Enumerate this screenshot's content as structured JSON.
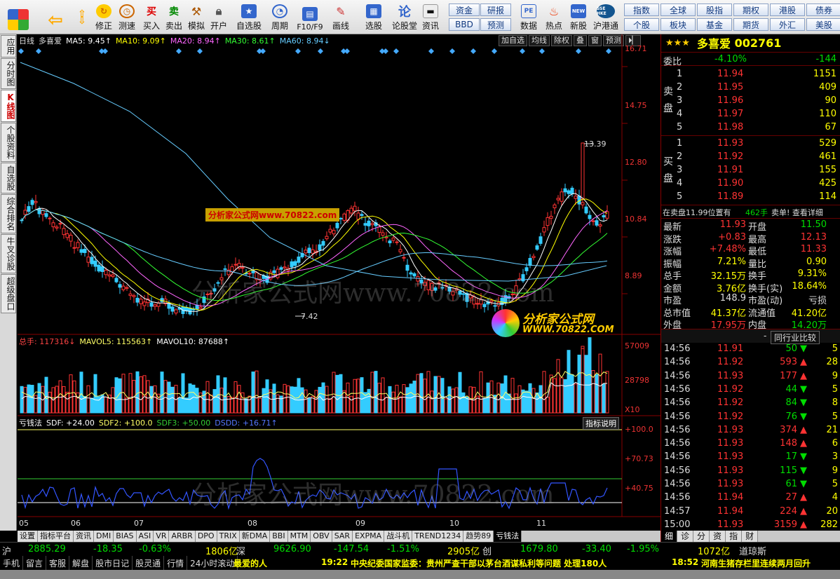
{
  "toolbar": {
    "items": [
      "修正",
      "测速",
      "买入",
      "卖出",
      "模拟",
      "开户",
      "自选股",
      "周期",
      "F10/F9",
      "画线",
      "选股",
      "论股堂",
      "资讯",
      "数据",
      "热点",
      "新股",
      "沪港通"
    ],
    "pe": "PE",
    "new_badge": "NEW",
    "hkex": "SSE HKE"
  },
  "nav": {
    "row1": [
      "资金",
      "研报",
      "指数",
      "全球",
      "股指",
      "期权",
      "港股",
      "债券"
    ],
    "row2": [
      "BBD",
      "预测",
      "个股",
      "板块",
      "基金",
      "期货",
      "外汇",
      "美股"
    ]
  },
  "left_tabs": [
    "应用",
    "分时图",
    "K线图",
    "个股资料",
    "自选股",
    "综合排名",
    "牛叉诊股",
    "超级盘口"
  ],
  "chart": {
    "period": "日线",
    "name": "多喜爱",
    "ma": [
      {
        "label": "MA5: 9.45↑",
        "color": "#ffffff"
      },
      {
        "label": "MA10: 9.09↑",
        "color": "#ffff00"
      },
      {
        "label": "MA20: 8.94↑",
        "color": "#ff66ff"
      },
      {
        "label": "MA30: 8.61↑",
        "color": "#33ff33"
      },
      {
        "label": "MA60: 8.94↓",
        "color": "#66ccff"
      }
    ],
    "tools": [
      "加自选",
      "均线",
      "除权",
      "叠",
      "窗",
      "预测"
    ],
    "y_labels": [
      "16.71",
      "14.75",
      "12.80",
      "10.84",
      "8.89"
    ],
    "high_label": "13.39",
    "low_label": "7.42",
    "vol_header": [
      {
        "label": "总手: 117316↓",
        "color": "#ff4444"
      },
      {
        "label": "MAVOL5: 115563↑",
        "color": "#ffff66"
      },
      {
        "label": "MAVOL10: 87688↑",
        "color": "#ffffff"
      }
    ],
    "vol_y": [
      "57009",
      "28798",
      "X10"
    ],
    "ind_header": [
      {
        "label": "亏钱法",
        "color": "#ffffff"
      },
      {
        "label": "SDF: +24.00",
        "color": "#ffffff"
      },
      {
        "label": "SDF2: +100.0",
        "color": "#ffff66"
      },
      {
        "label": "SDF3: +50.00",
        "color": "#33cc33"
      },
      {
        "label": "DSDD: +16.71↑",
        "color": "#5577ff"
      }
    ],
    "ind_button": "指标说明",
    "ind_y": [
      "+100.0",
      "+70.73",
      "+40.75"
    ],
    "x_labels": [
      "05",
      "06",
      "07",
      "08",
      "09",
      "10",
      "11"
    ],
    "watermark": "分析家公式网www.70822.com",
    "banner": "分析家公式网www.70822.com",
    "logo_text": "分析家公式网",
    "logo_url": "WWW.70822.COM"
  },
  "bottom_tabs": [
    "设置",
    "指标平台",
    "资讯",
    "DMI",
    "BIAS",
    "ASI",
    "VR",
    "ARBR",
    "DPO",
    "TRIX",
    "新DMA",
    "BBI",
    "MTM",
    "OBV",
    "SAR",
    "EXPMA",
    "战斗机",
    "TREND1234",
    "趋势89",
    "亏钱法"
  ],
  "quote": {
    "name": "多喜爱",
    "code": "002761",
    "stars": "★★★",
    "weibi_label": "委比",
    "weibi": "-4.10%",
    "weicha": "-144",
    "sell_label": "卖盘",
    "buy_label": "买盘",
    "sell": [
      {
        "n": "5",
        "p": "11.98",
        "v": "67"
      },
      {
        "n": "4",
        "p": "11.97",
        "v": "110"
      },
      {
        "n": "3",
        "p": "11.96",
        "v": "90"
      },
      {
        "n": "2",
        "p": "11.95",
        "v": "409"
      },
      {
        "n": "1",
        "p": "11.94",
        "v": "1151"
      }
    ],
    "buy": [
      {
        "n": "1",
        "p": "11.93",
        "v": "529"
      },
      {
        "n": "2",
        "p": "11.92",
        "v": "461"
      },
      {
        "n": "3",
        "p": "11.91",
        "v": "155"
      },
      {
        "n": "4",
        "p": "11.90",
        "v": "425"
      },
      {
        "n": "5",
        "p": "11.89",
        "v": "114"
      }
    ],
    "zaimai": "在卖盘11.99位置有",
    "zaimai_v": "462手",
    "zaimai_r": "卖单! 查看详细",
    "stats": [
      {
        "l1": "最新",
        "v1": "11.93",
        "c1": "red",
        "l2": "开盘",
        "v2": "11.50",
        "c2": "green"
      },
      {
        "l1": "涨跌",
        "v1": "+0.83",
        "c1": "red",
        "l2": "最高",
        "v2": "12.13",
        "c2": "red"
      },
      {
        "l1": "涨幅",
        "v1": "+7.48%",
        "c1": "red",
        "l2": "最低",
        "v2": "11.33",
        "c2": "red"
      },
      {
        "l1": "振幅",
        "v1": "7.21%",
        "c1": "yellow",
        "l2": "量比",
        "v2": "0.90",
        "c2": "yellow"
      },
      {
        "l1": "总手",
        "v1": "32.15万",
        "c1": "yellow",
        "l2": "换手",
        "v2": "9.31%",
        "c2": "yellow"
      },
      {
        "l1": "金额",
        "v1": "3.76亿",
        "c1": "yellow",
        "l2": "换手(实)",
        "v2": "18.64%",
        "c2": "yellow"
      },
      {
        "l1": "市盈",
        "v1": "148.9",
        "c1": "white",
        "l2": "市盈(动)",
        "v2": "亏损",
        "c2": "white"
      },
      {
        "l1": "总市值",
        "v1": "41.37亿",
        "c1": "yellow",
        "l2": "流通值",
        "v2": "41.20亿",
        "c2": "yellow"
      },
      {
        "l1": "外盘",
        "v1": "17.95万",
        "c1": "red",
        "l2": "内盘",
        "v2": "14.20万",
        "c2": "green"
      }
    ],
    "compare": "同行业比较",
    "dash": "-",
    "ticks": [
      {
        "t": "14:56",
        "p": "11.91",
        "v": "50",
        "d": "down",
        "n": "5"
      },
      {
        "t": "14:56",
        "p": "11.92",
        "v": "593",
        "d": "up",
        "n": "28"
      },
      {
        "t": "14:56",
        "p": "11.93",
        "v": "177",
        "d": "up",
        "n": "9"
      },
      {
        "t": "14:56",
        "p": "11.92",
        "v": "44",
        "d": "down",
        "n": "5"
      },
      {
        "t": "14:56",
        "p": "11.92",
        "v": "84",
        "d": "down",
        "n": "8"
      },
      {
        "t": "14:56",
        "p": "11.92",
        "v": "76",
        "d": "down",
        "n": "5"
      },
      {
        "t": "14:56",
        "p": "11.93",
        "v": "374",
        "d": "up",
        "n": "21"
      },
      {
        "t": "14:56",
        "p": "11.93",
        "v": "148",
        "d": "up",
        "n": "6"
      },
      {
        "t": "14:56",
        "p": "11.93",
        "v": "17",
        "d": "down",
        "n": "3"
      },
      {
        "t": "14:56",
        "p": "11.93",
        "v": "115",
        "d": "down",
        "n": "9"
      },
      {
        "t": "14:56",
        "p": "11.93",
        "v": "61",
        "d": "down",
        "n": "5"
      },
      {
        "t": "14:56",
        "p": "11.94",
        "v": "27",
        "d": "up",
        "n": "4"
      },
      {
        "t": "14:57",
        "p": "11.94",
        "v": "224",
        "d": "up",
        "n": "20"
      },
      {
        "t": "15:00",
        "p": "11.93",
        "v": "3159",
        "d": "up",
        "n": "282"
      }
    ],
    "rtabs": [
      "细",
      "诊",
      "分",
      "资",
      "指",
      "财"
    ]
  },
  "status": {
    "sh_label": "沪",
    "sh_v": "2885.29",
    "sh_c": "-18.35",
    "sh_p": "-0.63%",
    "sh_amt": "1806亿",
    "sz_label": "深",
    "sz_v": "9626.90",
    "sz_c": "-147.54",
    "sz_p": "-1.51%",
    "sz_amt": "2905亿",
    "cy_label": "创",
    "cy_v": "1679.80",
    "cy_c": "-33.40",
    "cy_p": "-1.95%",
    "cy_amt": "1072亿",
    "dj": "道琼斯"
  },
  "news": {
    "items": [
      "手机",
      "留言",
      "客服",
      "解盘",
      "股市日记",
      "股灵通",
      "行情",
      "24小时滚动"
    ],
    "n1": "最爱的人",
    "n2t": "19:22",
    "n2": "中央纪委国家监委：贵州严查干部以茅台酒谋私利等问题 处理180人",
    "n3t": "18:52",
    "n3": "河南生猪存栏里连续两月回升"
  }
}
